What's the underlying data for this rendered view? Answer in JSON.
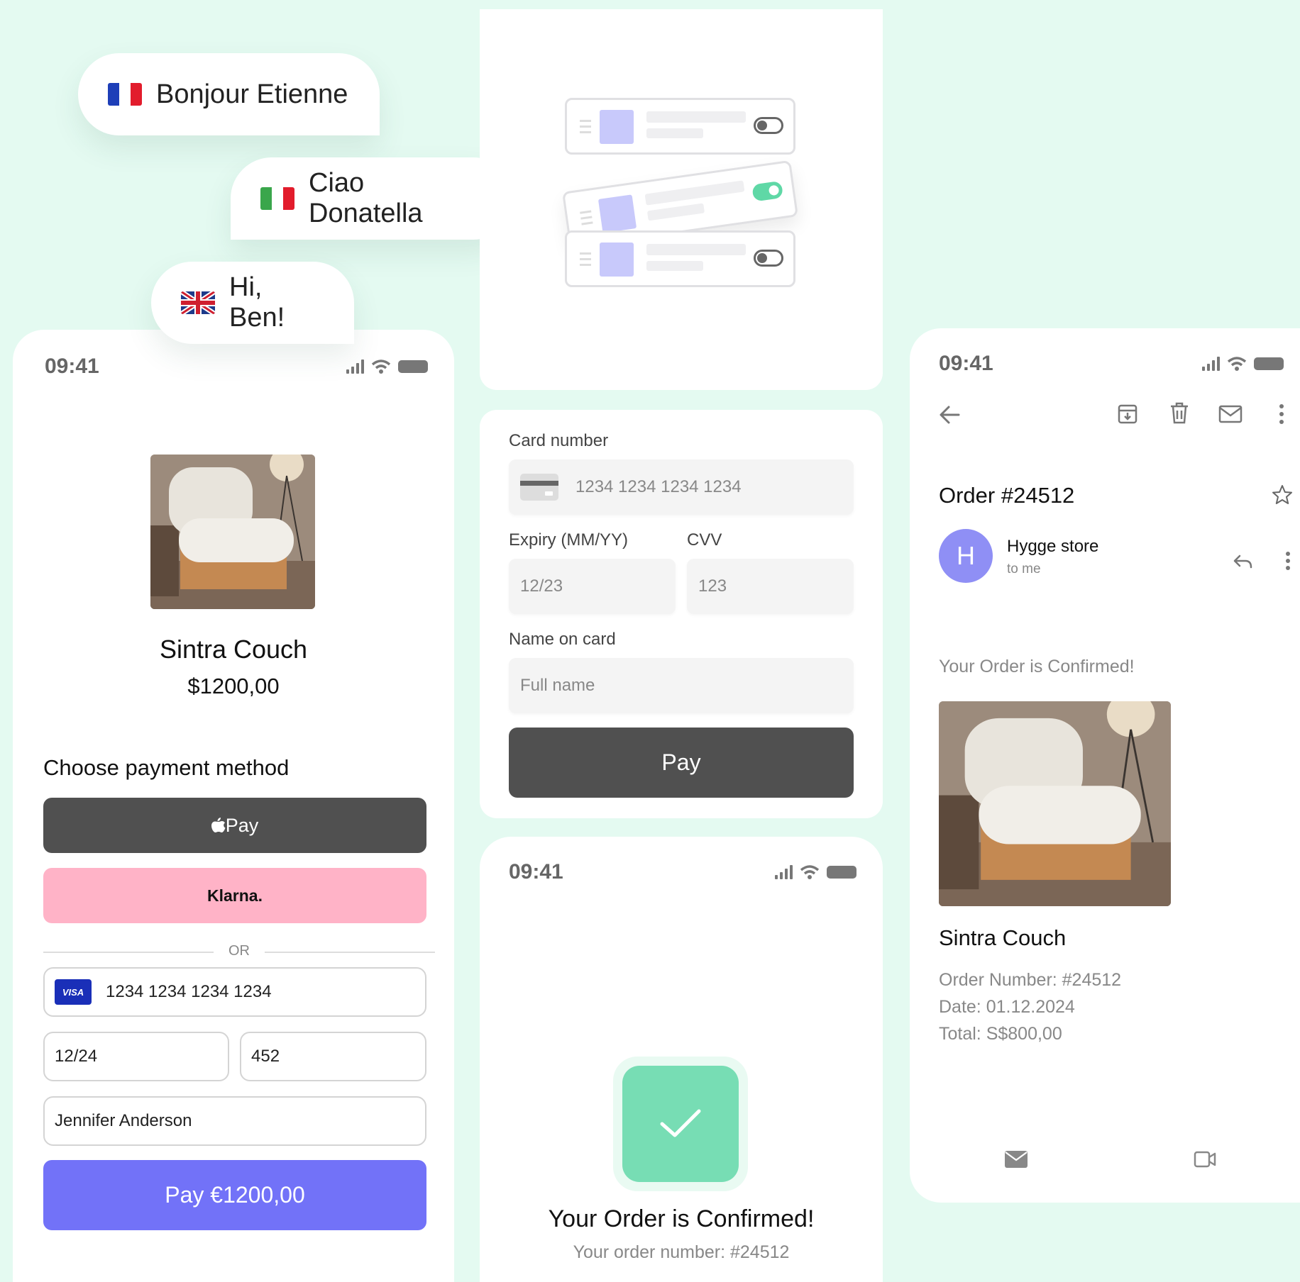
{
  "greetings": [
    {
      "text": "Bonjour Etienne",
      "flag": "flag-france",
      "colors": [
        "#1e3fb8",
        "#ffffff",
        "#e21c2c"
      ]
    },
    {
      "text": "Ciao Donatella",
      "flag": "flag-italy",
      "colors": [
        "#3aa64b",
        "#ffffff",
        "#e21c2c"
      ]
    },
    {
      "text": "Hi, Ben!",
      "flag": "flag-uk",
      "colors": [
        "#1e3a8a",
        "#ffffff",
        "#cf1f2f"
      ]
    }
  ],
  "checkout": {
    "status_time": "09:41",
    "product_name": "Sintra Couch",
    "product_price": "$1200,00",
    "section_title": "Choose payment method",
    "apple_pay_label": "Pay",
    "klarna_label": "Klarna.",
    "divider_text": "OR",
    "card_brand": "VISA",
    "card_number": "1234 1234 1234 1234",
    "expiry": "12/24",
    "cvv": "452",
    "name": "Jennifer Anderson",
    "pay_button": "Pay €1200,00",
    "accent": "#7272f8",
    "klarna_color": "#ffb3c7"
  },
  "card_form": {
    "card_number_label": "Card number",
    "card_number_placeholder": "1234 1234 1234 1234",
    "expiry_label": "Expiry (MM/YY)",
    "expiry_placeholder": "12/23",
    "cvv_label": "CVV",
    "cvv_placeholder": "123",
    "name_label": "Name on card",
    "name_placeholder": "Full name",
    "pay_button": "Pay"
  },
  "confirmation": {
    "status_time": "09:41",
    "title": "Your Order is Confirmed!",
    "subtitle": "Your order number: #24512",
    "check_color": "#77ddb4"
  },
  "email": {
    "status_time": "09:41",
    "subject": "Order #24512",
    "sender_initial": "H",
    "sender_name": "Hygge store",
    "recipient": "to me",
    "heading": "Your Order is Confirmed!",
    "product_name": "Sintra Couch",
    "order_number": "Order Number: #24512",
    "date": "Date: 01.12.2024",
    "total": "Total: S$800,00",
    "avatar_color": "#8f8ff5"
  }
}
